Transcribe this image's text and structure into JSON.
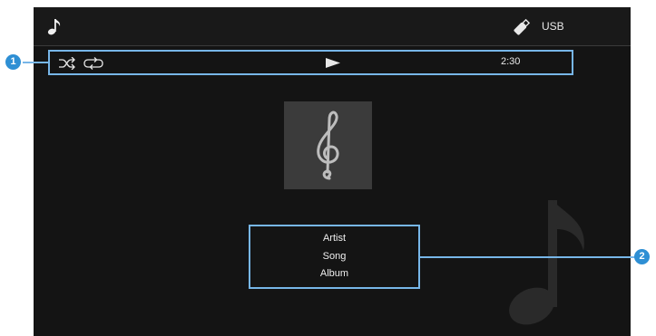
{
  "header": {
    "source_label": "USB",
    "music_icon": "music-note-icon",
    "source_icon": "usb-drive-icon"
  },
  "playback": {
    "shuffle_icon": "shuffle-icon",
    "repeat_icon": "repeat-icon",
    "state_icon": "play-icon",
    "elapsed_time": "2:30"
  },
  "album_art": {
    "icon": "treble-clef-icon"
  },
  "track_info": {
    "artist": "Artist",
    "song": "Song",
    "album": "Album"
  },
  "callouts": [
    {
      "label": "1"
    },
    {
      "label": "2"
    }
  ],
  "colors": {
    "screen_bg": "#141414",
    "highlight": "#77b6e8",
    "callout": "#2e8fd4"
  }
}
